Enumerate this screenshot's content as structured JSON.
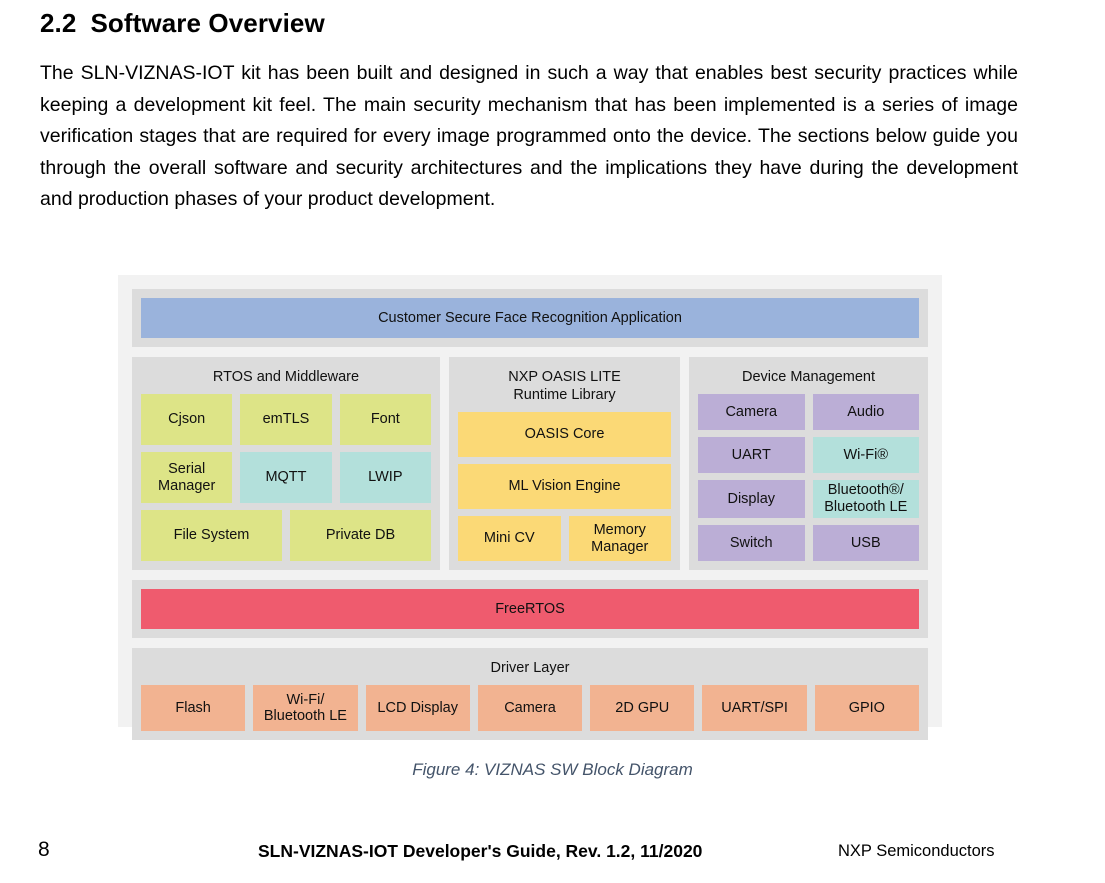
{
  "heading": {
    "number": "2.2",
    "title": "Software Overview"
  },
  "paragraph": {
    "text": "The SLN-VIZNAS-IOT kit has been built and designed in such a way that enables best security practices while keeping a development kit feel. The main security mechanism that has been implemented is a series of image verification stages that are required for every image programmed onto the device. The sections below guide you through the overall software and security architectures and the implications they have during the development and production phases of your product development."
  },
  "diagram": {
    "application_bar": {
      "label": "Customer Secure Face Recognition Application",
      "color": "#9ab3dc"
    },
    "rtos_middleware": {
      "title": "RTOS and Middleware",
      "rows": [
        [
          {
            "label": "Cjson",
            "color": "#dde487"
          },
          {
            "label": "emTLS",
            "color": "#dde487"
          },
          {
            "label": "Font",
            "color": "#dde487"
          }
        ],
        [
          {
            "label": "Serial Manager",
            "color": "#dde487"
          },
          {
            "label": "MQTT",
            "color": "#b3e0db"
          },
          {
            "label": "LWIP",
            "color": "#b3e0db"
          }
        ],
        [
          {
            "label": "File System",
            "color": "#dde487"
          },
          {
            "label": "Private DB",
            "color": "#dde487"
          }
        ]
      ]
    },
    "oasis_lite": {
      "title_line1": "NXP OASIS LITE",
      "title_line2": "Runtime Library",
      "rows": [
        [
          {
            "label": "OASIS Core",
            "color": "#fbd976"
          }
        ],
        [
          {
            "label": "ML Vision Engine",
            "color": "#fbd976"
          }
        ],
        [
          {
            "label": "Mini CV",
            "color": "#fbd976"
          },
          {
            "label": "Memory Manager",
            "color": "#fbd976"
          }
        ]
      ]
    },
    "device_management": {
      "title": "Device Management",
      "rows": [
        [
          {
            "label": "Camera",
            "color": "#bbaed6"
          },
          {
            "label": "Audio",
            "color": "#bbaed6"
          }
        ],
        [
          {
            "label": "UART",
            "color": "#bbaed6"
          },
          {
            "label": "Wi-Fi®",
            "color": "#b3e0db"
          }
        ],
        [
          {
            "label": "Display",
            "color": "#bbaed6"
          },
          {
            "label": "Bluetooth®/ Bluetooth LE",
            "color": "#b3e0db"
          }
        ],
        [
          {
            "label": "Switch",
            "color": "#bbaed6"
          },
          {
            "label": "USB",
            "color": "#bbaed6"
          }
        ]
      ]
    },
    "freertos_bar": {
      "label": "FreeRTOS",
      "color": "#ef5b6e"
    },
    "driver_layer": {
      "title": "Driver Layer",
      "cells": [
        {
          "label": "Flash",
          "color": "#f2b391"
        },
        {
          "label": "Wi-Fi/ Bluetooth LE",
          "color": "#f2b391"
        },
        {
          "label": "LCD Display",
          "color": "#f2b391"
        },
        {
          "label": "Camera",
          "color": "#f2b391"
        },
        {
          "label": "2D GPU",
          "color": "#f2b391"
        },
        {
          "label": "UART/SPI",
          "color": "#f2b391"
        },
        {
          "label": "GPIO",
          "color": "#f2b391"
        }
      ]
    }
  },
  "figure_caption": "Figure 4: VIZNAS SW Block Diagram",
  "footer": {
    "page_number": "8",
    "document_title": "SLN-VIZNAS-IOT Developer's Guide, Rev. 1.2, 11/2020",
    "company": "NXP Semiconductors"
  }
}
